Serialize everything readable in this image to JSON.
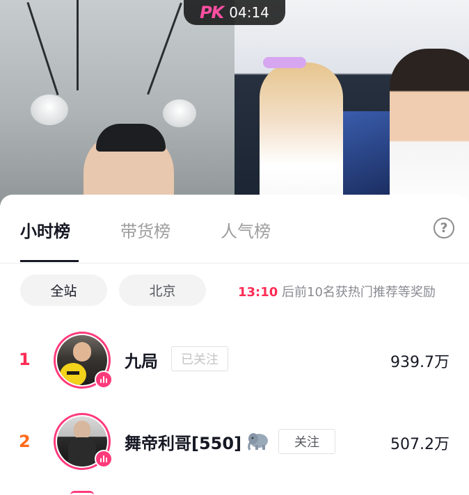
{
  "pk_bar": {
    "logo": "PK",
    "timer": "04:14"
  },
  "tabs": [
    {
      "label": "小时榜",
      "active": true
    },
    {
      "label": "带货榜",
      "active": false
    },
    {
      "label": "人气榜",
      "active": false
    }
  ],
  "help": {
    "glyph": "?"
  },
  "filters": [
    {
      "label": "全站",
      "active": true
    },
    {
      "label": "北京",
      "active": false
    }
  ],
  "notice": {
    "time": "13:10",
    "text": " 后前10名获热门推荐等奖励"
  },
  "ranking": [
    {
      "rank": "1",
      "name": "九局",
      "follow_label": "已关注",
      "score": "939.7万"
    },
    {
      "rank": "2",
      "name": "舞帝利哥[550]",
      "follow_label": "关注",
      "score": "507.2万"
    }
  ],
  "colors": {
    "accent": "#fe2c55",
    "rank2": "#ff6a1a",
    "ring": "#ff3a7a"
  }
}
